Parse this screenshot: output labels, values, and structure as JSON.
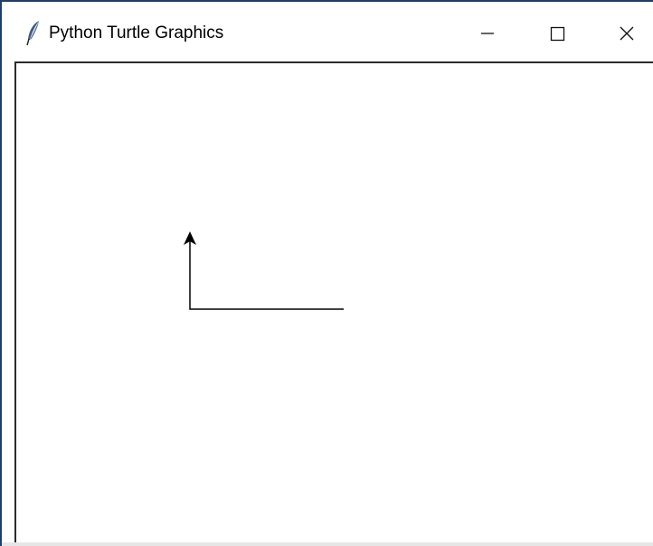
{
  "window": {
    "title": "Python Turtle Graphics",
    "icon": "feather-icon",
    "controls": [
      "minimize-icon",
      "maximize-icon",
      "close-icon"
    ]
  },
  "canvas": {
    "background": "#ffffff",
    "pen_color": "#000000",
    "turtle_shape": "classic-arrow",
    "turtle_heading": "up"
  }
}
